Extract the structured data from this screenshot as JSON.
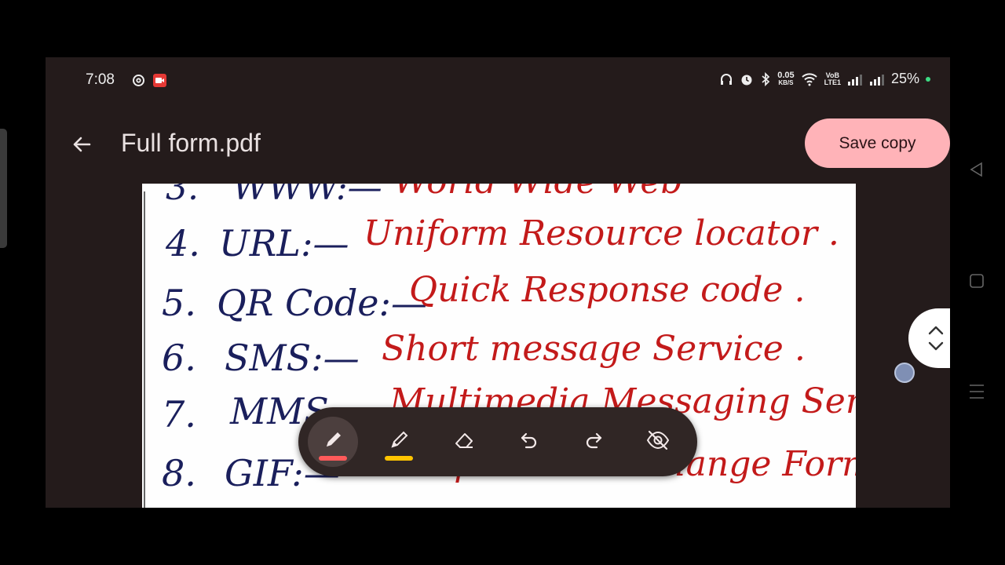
{
  "status_bar": {
    "time": "7:08",
    "net_speed_value": "0.05",
    "net_speed_unit": "KB/S",
    "volte_top": "VoB",
    "volte_bottom": "LTE1",
    "battery_percent": "25%",
    "icons": [
      "threads-icon",
      "screen-record-icon",
      "headphones-icon",
      "alarm-icon",
      "bluetooth-icon",
      "wifi-icon",
      "signal-icon",
      "signal-icon-2"
    ]
  },
  "top_bar": {
    "title": "Full form.pdf",
    "save_label": "Save copy",
    "back_icon": "arrow-left-icon"
  },
  "document": {
    "lines": [
      {
        "num": "3.",
        "abbr": "WWW:—",
        "full": "World Wide Web"
      },
      {
        "num": "4.",
        "abbr": "URL:—",
        "full": "Uniform Resource locator ."
      },
      {
        "num": "5.",
        "abbr": "QR Code:—",
        "full": "Quick Response code ."
      },
      {
        "num": "6.",
        "abbr": "SMS:—",
        "full": "Short message Service ."
      },
      {
        "num": "7.",
        "abbr": "MMS:—",
        "full": "Multimedia Messaging Service ."
      },
      {
        "num": "8.",
        "abbr": "GIF:—",
        "full": "Graphics Interchange Format ."
      }
    ]
  },
  "toolbar": {
    "tools": [
      {
        "name": "pen",
        "icon": "pen-icon",
        "color": "#ff5a5a",
        "selected": true
      },
      {
        "name": "highlighter",
        "icon": "highlighter-icon",
        "color": "#ffc400",
        "selected": false
      },
      {
        "name": "eraser",
        "icon": "eraser-icon"
      },
      {
        "name": "undo",
        "icon": "undo-icon"
      },
      {
        "name": "redo",
        "icon": "redo-icon"
      },
      {
        "name": "hide-annotations",
        "icon": "eye-off-icon"
      }
    ]
  },
  "colors": {
    "accent": "#ffb3b8",
    "background": "#241b1b",
    "ink_blue": "#1a1f5c",
    "ink_red": "#c31a1a"
  },
  "nav_bar": {
    "icons": [
      "back-triangle-icon",
      "home-square-icon",
      "menu-lines-icon"
    ]
  }
}
